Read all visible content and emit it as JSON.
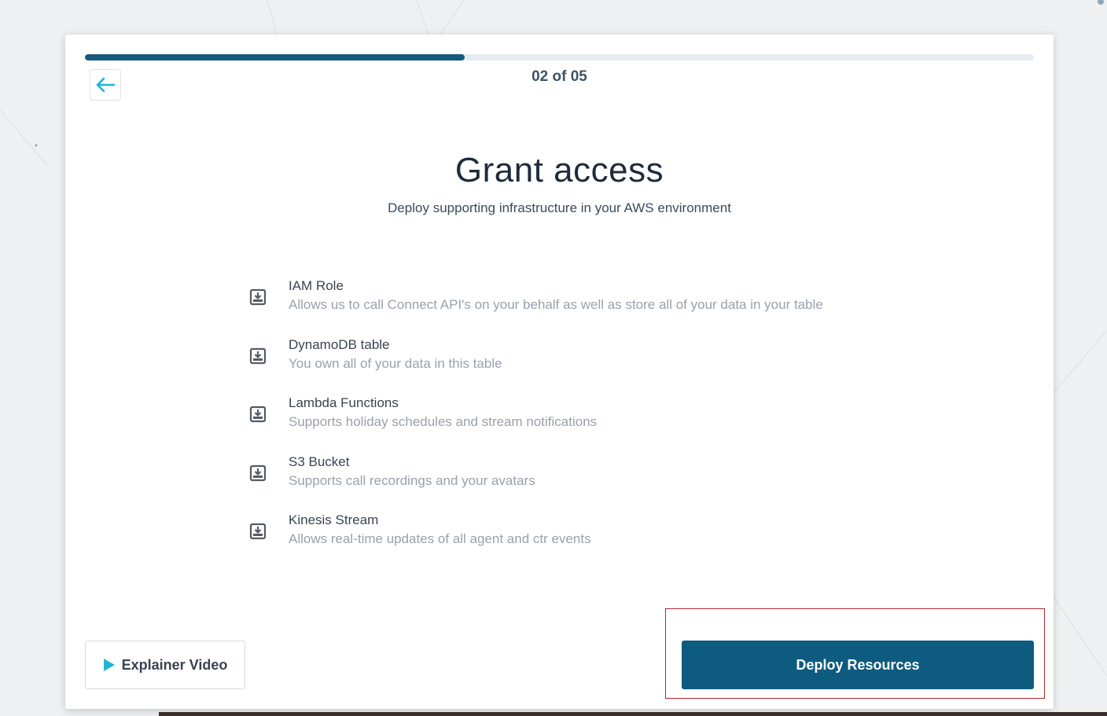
{
  "wizard": {
    "progress": 0.4,
    "step_counter": "02 of 05",
    "title": "Grant access",
    "subtitle": "Deploy supporting infrastructure in your AWS environment"
  },
  "resources": [
    {
      "name": "IAM Role",
      "description": "Allows us to call Connect API's on your behalf as well as store all of your data in your table"
    },
    {
      "name": "DynamoDB table",
      "description": "You own all of your data in this table"
    },
    {
      "name": "Lambda Functions",
      "description": "Supports holiday schedules and stream notifications"
    },
    {
      "name": "S3 Bucket",
      "description": "Supports call recordings and your avatars"
    },
    {
      "name": "Kinesis Stream",
      "description": "Allows real-time updates of all agent and ctr events"
    }
  ],
  "actions": {
    "explainer_label": "Explainer Video",
    "deploy_label": "Deploy Resources"
  },
  "icons": {
    "back": "arrow-left-icon",
    "resource": "download-box-icon",
    "play": "play-icon"
  },
  "colors": {
    "primary": "#0e5b80",
    "progress": "#155a7c",
    "accent": "#1fb6d2",
    "highlight": "#b3262c"
  }
}
